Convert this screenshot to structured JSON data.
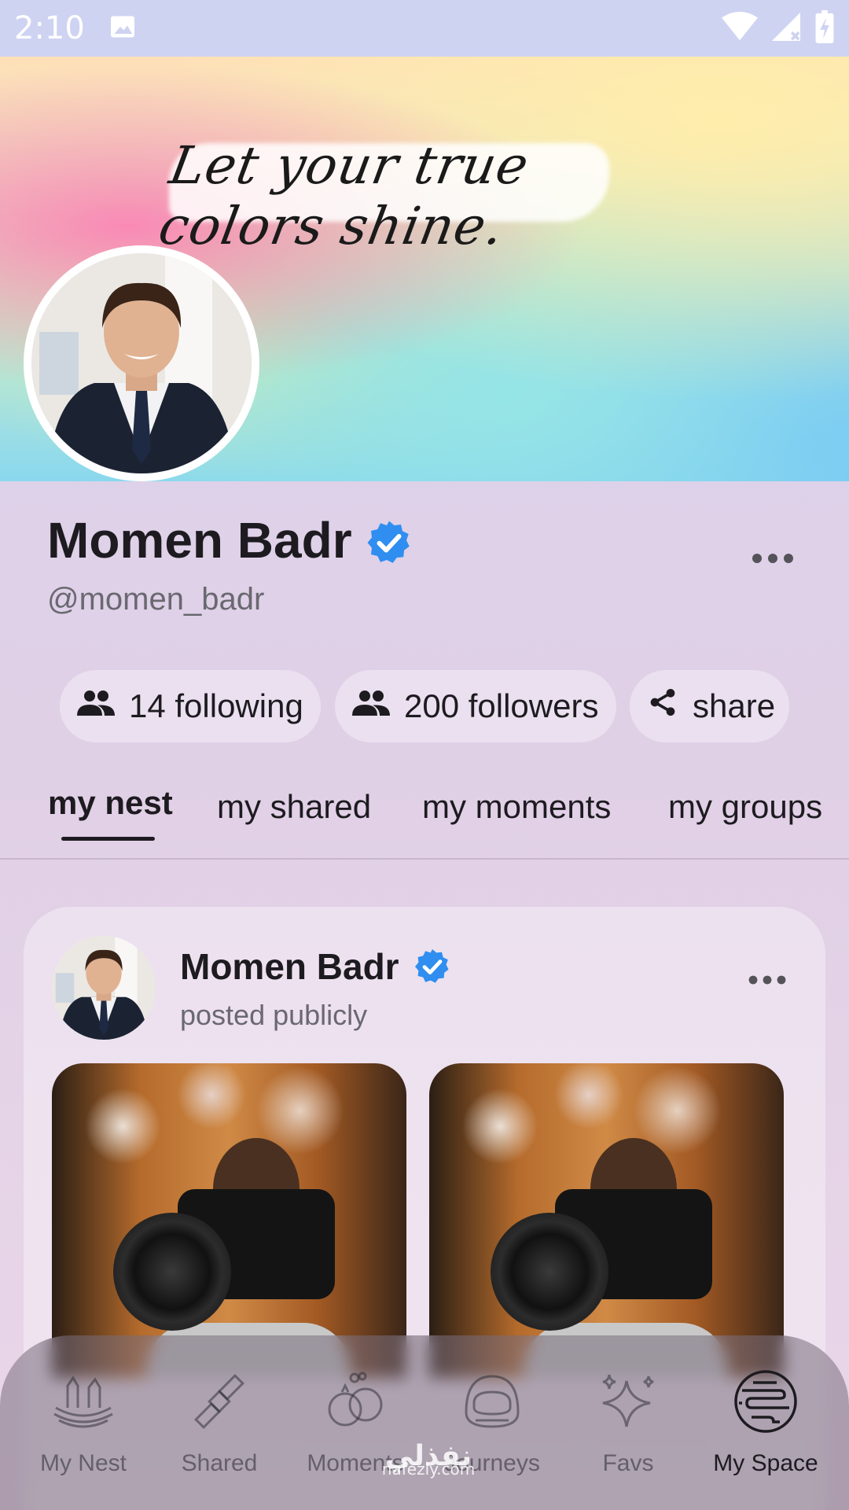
{
  "status_bar": {
    "time": "2:10"
  },
  "cover": {
    "quote": "Let your true colors shine."
  },
  "profile": {
    "name": "Momen Badr",
    "handle": "@momen_badr",
    "verified": true
  },
  "chips": {
    "following": "14 following",
    "followers": "200 followers",
    "share": "share"
  },
  "tabs": [
    {
      "label": "my nest",
      "active": true
    },
    {
      "label": "my shared",
      "active": false
    },
    {
      "label": "my moments",
      "active": false
    },
    {
      "label": "my groups",
      "active": false
    }
  ],
  "post": {
    "author": "Momen Badr",
    "meta": "posted publicly"
  },
  "bottom_nav": [
    {
      "label": "My Nest",
      "icon": "nest-icon",
      "active": false
    },
    {
      "label": "Shared",
      "icon": "satellite-icon",
      "active": false
    },
    {
      "label": "Moments",
      "icon": "rings-icon",
      "active": false
    },
    {
      "label": "Journeys",
      "icon": "astronaut-helmet-icon",
      "active": false
    },
    {
      "label": "Favs",
      "icon": "sparkles-icon",
      "active": false
    },
    {
      "label": "My Space",
      "icon": "planet-icon",
      "active": true
    }
  ],
  "watermark": {
    "logo": "نفذلي",
    "site": "nafezly.com"
  },
  "colors": {
    "verified": "#2f8ef0",
    "text": "#1d1b20",
    "muted": "#6a6870"
  }
}
